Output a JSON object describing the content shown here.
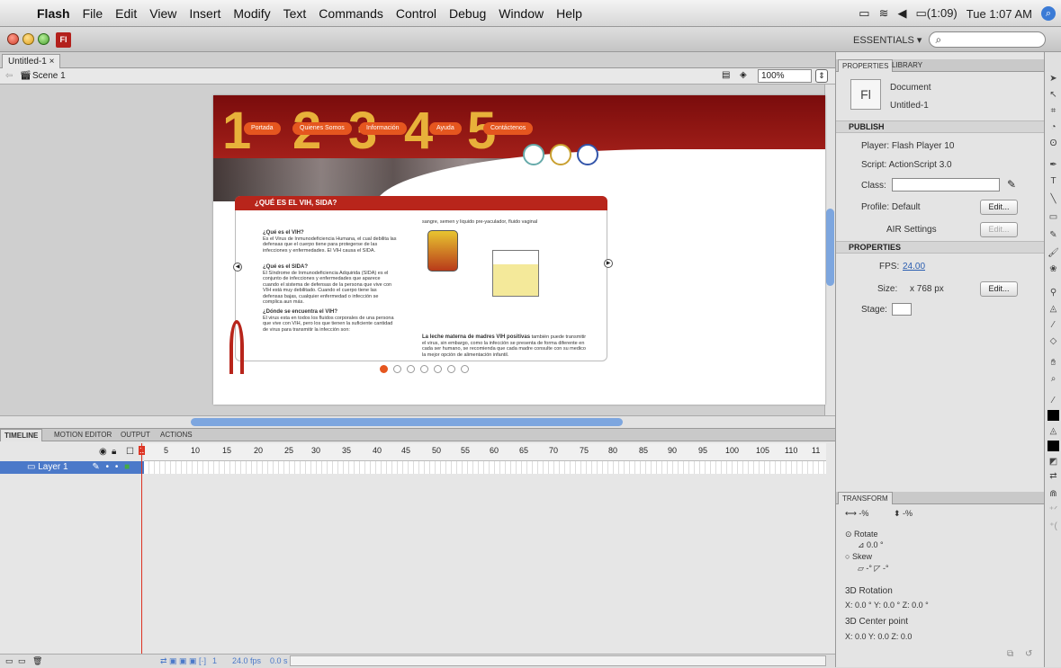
{
  "menubar": {
    "items": [
      "Flash",
      "File",
      "Edit",
      "View",
      "Insert",
      "Modify",
      "Text",
      "Commands",
      "Control",
      "Debug",
      "Window",
      "Help"
    ],
    "battery": "(1:09)",
    "clock": "Tue 1:07 AM"
  },
  "app": {
    "logo": "Fl",
    "workspace": "ESSENTIALS ▾",
    "search_icon": "⌕"
  },
  "document": {
    "tab": "Untitled-1",
    "scene": "Scene 1",
    "zoom": "100%"
  },
  "stage": {
    "nums": [
      "1",
      "2",
      "3",
      "4",
      "5"
    ],
    "nav": [
      "Portada",
      "Quienes Somos",
      "Información",
      "Ayuda",
      "Contáctenos"
    ],
    "card_title": "¿QUÉ ES EL VIH, SIDA?",
    "q1": "¿Qué es el VIH?",
    "a1": "Es el Virus de Inmunodeficiencia Humana, el cual debilita las defensas que el cuerpo tiene para protegerse de las infecciones y enfermedades. El VIH causa el SIDA.",
    "q2": "¿Qué es el SIDA?",
    "a2": "El Síndrome de Inmunodeficiencia Adquirida (SIDA) es el conjunto de infecciones y enfermedades que aparece cuando el sistema de defensas de la persona que vive con VIH está muy debilitado. Cuando el cuerpo tiene las defensas bajas, cualquier enfermedad o infección se complica aun más.",
    "q3": "¿Dónde se encuentra el VIH?",
    "a3": "El virus esta en todos los fluidos corporales de una persona que vive con VIH, pero los que tienen la suficiente cantidad de virus para transmitir la infección son:",
    "top_right": "sangre, semen y liquido pre-yaculador, fluido vaginal",
    "bottom_right_bold": "La leche materna de madres VIH positivas",
    "bottom_right": "también puede transmitir el virus, sin embargo, como la infección se presenta de forma diferente en cada ser humano, se recomienda que cada madre consulte con su medico la mejor opción de alimentación infantil."
  },
  "properties": {
    "tabs": [
      "PROPERTIES",
      "LIBRARY"
    ],
    "doc_type": "Document",
    "doc_name": "Untitled-1",
    "publish": "PUBLISH",
    "player": "Player: Flash Player 10",
    "script": "Script: ActionScript 3.0",
    "class_label": "Class:",
    "profile": "Profile: Default",
    "edit": "Edit...",
    "air": "AIR Settings",
    "props_section": "PROPERTIES",
    "fps_label": "FPS:",
    "fps": "24.00",
    "size_label": "Size:",
    "size": "x 768 px",
    "stage_label": "Stage:"
  },
  "transform": {
    "title": "TRANSFORM",
    "w": "⟷ -%",
    "h": "⬍ -%",
    "rotate": "Rotate",
    "rotate_val": "⊿ 0.0 °",
    "skew": "Skew",
    "skew_vals": "▱ -°     ◸ -°",
    "rot3d": "3D Rotation",
    "rot3d_vals": "X: 0.0 °    Y: 0.0 °    Z: 0.0 °",
    "center": "3D Center point",
    "center_vals": "X: 0.0      Y: 0.0      Z: 0.0"
  },
  "timeline": {
    "tabs": [
      "TIMELINE",
      "MOTION EDITOR",
      "OUTPUT",
      "ACTIONS"
    ],
    "ruler": [
      "1",
      "5",
      "10",
      "15",
      "20",
      "25",
      "30",
      "35",
      "40",
      "45",
      "50",
      "55",
      "60",
      "65",
      "70",
      "75",
      "80",
      "85",
      "90",
      "95",
      "100",
      "105",
      "110",
      "11"
    ],
    "layer": "Layer 1",
    "fps": "24.0 fps",
    "time": "0.0 s",
    "frame": "1"
  },
  "colors": {
    "accent": "#4b79c9",
    "banner": "#a4201a",
    "orange": "#e5561f"
  }
}
